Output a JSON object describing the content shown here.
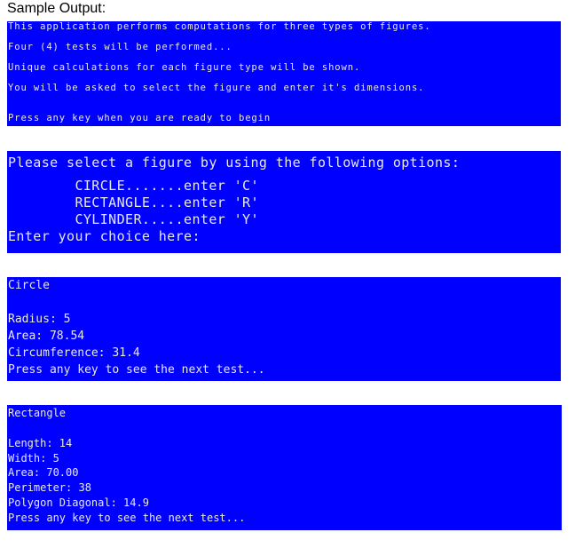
{
  "heading": "Sample Output:",
  "panels": {
    "intro": {
      "lines": [
        "This application performs computations for three types of figures.",
        "Four (4) tests will be performed...",
        "Unique calculations for each figure type will be shown.",
        "You will be asked to select the figure and enter it's dimensions.",
        "Press any key when you are ready to begin"
      ]
    },
    "menu": {
      "title": "Please select a figure by using the following options:",
      "options": [
        "        CIRCLE.......enter 'C'",
        "        RECTANGLE....enter 'R'",
        "        CYLINDER.....enter 'Y'"
      ],
      "prompt": "Enter your choice here:"
    },
    "circle": {
      "title": "Circle",
      "lines": [
        "Radius: 5",
        "Area: 78.54",
        "Circumference: 31.4",
        "Press any key to see the next test..."
      ]
    },
    "rectangle": {
      "title": "Rectangle",
      "lines": [
        "Length: 14",
        "Width: 5",
        "Area: 70.00",
        "Perimeter: 38",
        "Polygon Diagonal: 14.9",
        "Press any key to see the next test..."
      ]
    }
  },
  "colors": {
    "console_background": "#0000ff",
    "console_text": "#e8e8e8"
  }
}
